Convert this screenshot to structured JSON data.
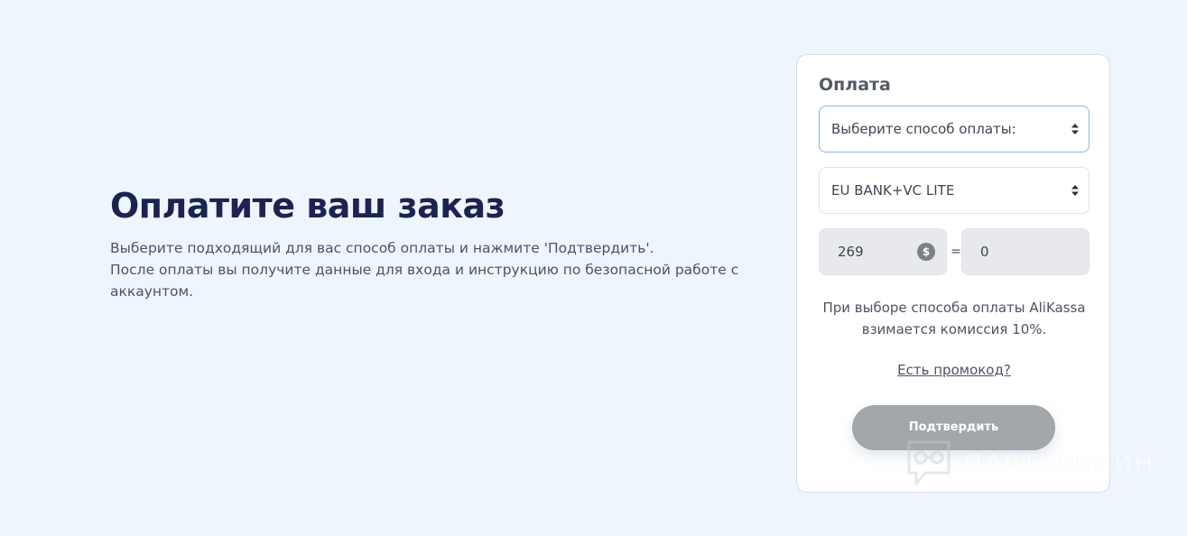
{
  "page": {
    "title": "Оплатите ваш заказ",
    "description_line1": "Выберите подходящий для вас способ оплаты и нажмите 'Подтвердить'.",
    "description_line2": "После оплаты вы получите данные для входа и инструкцию по безопасной работе с аккаунтом."
  },
  "payment": {
    "title": "Оплата",
    "method_select": "Выберите способ оплаты:",
    "product_select": "EU BANK+VC LITE",
    "amount": "269",
    "currency_icon": "dollar-coin-icon",
    "equals": "=",
    "converted_amount": "0",
    "note_line1": "При выборе способа оплаты AliKassa",
    "note_line2": "взимается комиссия 10%.",
    "promo_link": "Есть промокод?",
    "confirm_button": "Подтвердить"
  },
  "watermark": {
    "text": "ПАРТНЕРКИН",
    "icon": "chat-glasses-logo"
  },
  "colors": {
    "background": "#eef5fd",
    "heading": "#1b2450",
    "button_disabled": "#a3a7ac",
    "select_focus_border": "#86b6e3"
  }
}
